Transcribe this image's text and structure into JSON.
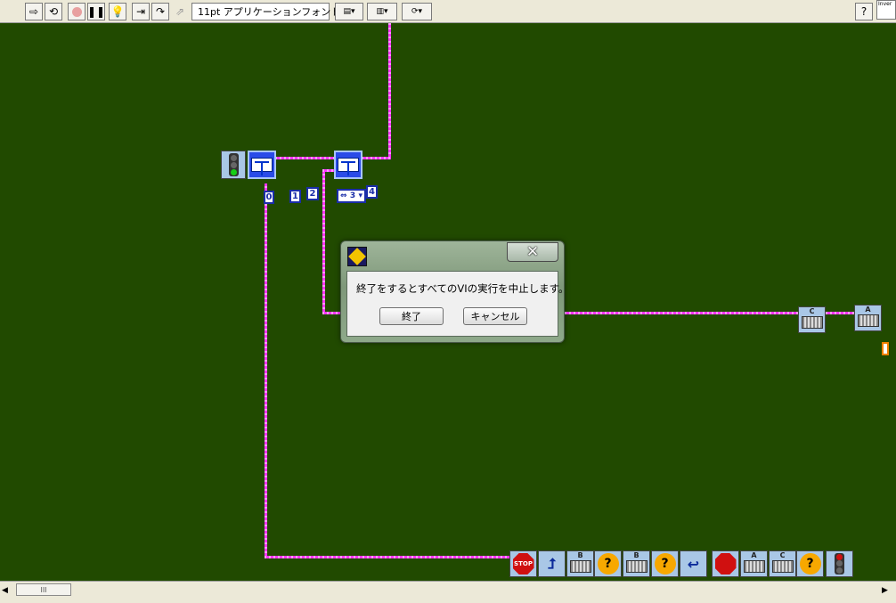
{
  "toolbar": {
    "font_name": "11pt アプリケーションフォント",
    "help": "?",
    "right_field": "Inver"
  },
  "diagram": {
    "frame_numbers": [
      "0",
      "1",
      "2",
      "4"
    ],
    "selector_value": "3",
    "block_labels": [
      "C",
      "A",
      "B",
      "B",
      "A",
      "C"
    ],
    "stop_label": "STOP"
  },
  "dialog": {
    "message": "終了をするとすべてのVIの実行を中止します。",
    "ok_label": "終了",
    "cancel_label": "キャンセル"
  },
  "scrollbar": {
    "thumb_grip": "III"
  },
  "colors": {
    "background": "#214a00",
    "wire": "#ff33ff",
    "block": "#a9c7e6"
  }
}
